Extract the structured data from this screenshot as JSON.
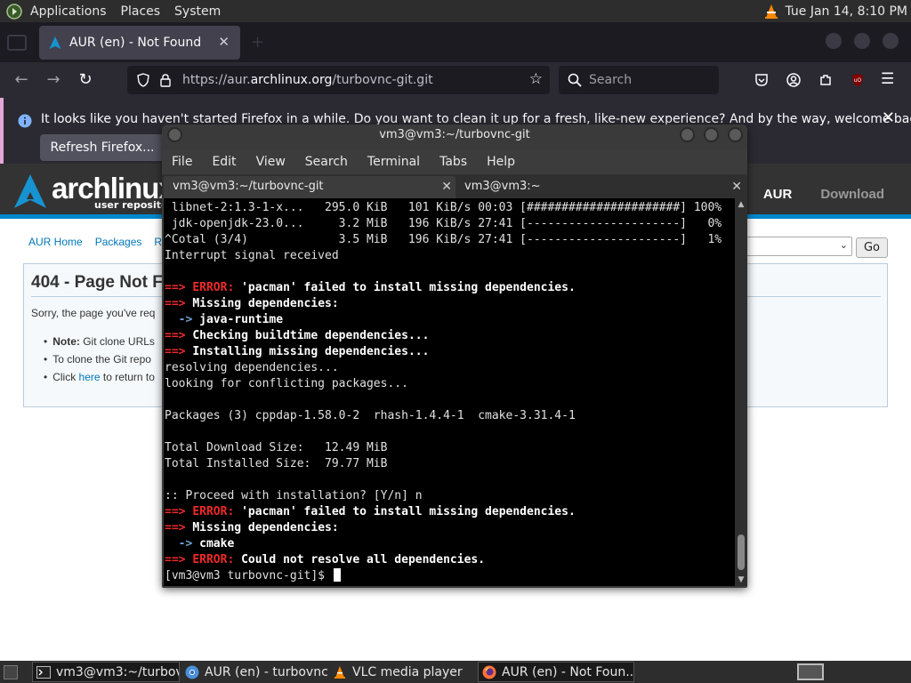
{
  "top_panel": {
    "menus": [
      "Applications",
      "Places",
      "System"
    ],
    "datetime": "Tue Jan 14,  8:10 PM"
  },
  "firefox": {
    "tab_title": "AUR (en) - Not Found",
    "url_prefix": "https://aur.",
    "url_domain": "archlinux.org",
    "url_path": "/turbovnc-git.git",
    "search_placeholder": "Search",
    "notice_text": "It looks like you haven't started Firefox in a while. Do you want to clean it up for a fresh, like-new experience? And by the way, welcome back!",
    "refresh_button": "Refresh Firefox..."
  },
  "aur": {
    "logo_text": "archlinux",
    "logo_sub": "user repository",
    "nav": [
      "AUR",
      "Download"
    ],
    "subnav": [
      "AUR Home",
      "Packages",
      "Re"
    ],
    "go_button": "Go",
    "error_title": "404 - Page Not F",
    "error_text": "Sorry, the page you've req",
    "bullets": [
      {
        "bold": "Note:",
        "text": " Git clone URLs"
      },
      {
        "bold": "",
        "text": "To clone the Git repo"
      },
      {
        "bold": "",
        "text": "Click ",
        "link": "here",
        "after": " to return to"
      }
    ]
  },
  "terminal": {
    "title": "vm3@vm3:~/turbovnc-git",
    "menus": [
      "File",
      "Edit",
      "View",
      "Search",
      "Terminal",
      "Tabs",
      "Help"
    ],
    "tabs": [
      "vm3@vm3:~/turbovnc-git",
      "vm3@vm3:~"
    ],
    "lines": [
      [
        {
          "t": " libnet-2:1.3-1-x...   295.0 KiB   101 KiB/s 00:03 [######################] 100%"
        }
      ],
      [
        {
          "t": " jdk-openjdk-23.0...     3.2 MiB   196 KiB/s 27:41 [----------------------]   0%"
        }
      ],
      [
        {
          "t": "^Cotal (3/4)             3.5 MiB   196 KiB/s 27:41 [----------------------]   1%"
        }
      ],
      [
        {
          "t": "Interrupt signal received"
        }
      ],
      [
        {
          "t": ""
        }
      ],
      [
        {
          "t": "==> ",
          "c": "red"
        },
        {
          "t": "ERROR: ",
          "c": "red"
        },
        {
          "t": "'pacman' failed to install missing dependencies.",
          "c": "b"
        }
      ],
      [
        {
          "t": "==> ",
          "c": "red"
        },
        {
          "t": "Missing dependencies:",
          "c": "b"
        }
      ],
      [
        {
          "t": "  -> ",
          "c": "blue"
        },
        {
          "t": "java-runtime",
          "c": "b"
        }
      ],
      [
        {
          "t": "==> ",
          "c": "red"
        },
        {
          "t": "Checking buildtime dependencies...",
          "c": "b"
        }
      ],
      [
        {
          "t": "==> ",
          "c": "red"
        },
        {
          "t": "Installing missing dependencies...",
          "c": "b"
        }
      ],
      [
        {
          "t": "resolving dependencies..."
        }
      ],
      [
        {
          "t": "looking for conflicting packages..."
        }
      ],
      [
        {
          "t": ""
        }
      ],
      [
        {
          "t": "Packages (3) cppdap-1.58.0-2  rhash-1.4.4-1  cmake-3.31.4-1"
        }
      ],
      [
        {
          "t": ""
        }
      ],
      [
        {
          "t": "Total Download Size:   12.49 MiB"
        }
      ],
      [
        {
          "t": "Total Installed Size:  79.77 MiB"
        }
      ],
      [
        {
          "t": ""
        }
      ],
      [
        {
          "t": ":: Proceed with installation? [Y/n] n"
        }
      ],
      [
        {
          "t": "==> ",
          "c": "red"
        },
        {
          "t": "ERROR: ",
          "c": "red"
        },
        {
          "t": "'pacman' failed to install missing dependencies.",
          "c": "b"
        }
      ],
      [
        {
          "t": "==> ",
          "c": "red"
        },
        {
          "t": "Missing dependencies:",
          "c": "b"
        }
      ],
      [
        {
          "t": "  -> ",
          "c": "blue"
        },
        {
          "t": "cmake",
          "c": "b"
        }
      ],
      [
        {
          "t": "==> ",
          "c": "red"
        },
        {
          "t": "ERROR: ",
          "c": "red"
        },
        {
          "t": "Could not resolve all dependencies.",
          "c": "b"
        }
      ],
      [
        {
          "t": "[vm3@vm3 turbovnc-git]$ "
        }
      ]
    ]
  },
  "taskbar": {
    "tasks": [
      {
        "label": "vm3@vm3:~/turbov...",
        "icon": "terminal-icon",
        "active": true
      },
      {
        "label": "AUR (en) - turbovnc...",
        "icon": "chromium-icon",
        "active": false
      },
      {
        "label": "VLC media player",
        "icon": "vlc-icon",
        "active": false
      },
      {
        "label": "AUR (en) - Not Foun...",
        "icon": "firefox-icon",
        "active": true
      }
    ]
  },
  "colors": {
    "terminal_error": "#ef2929",
    "terminal_arrow": "#729fcf",
    "aur_accent": "#0088cc",
    "notice_border": "#e7a6d8"
  }
}
